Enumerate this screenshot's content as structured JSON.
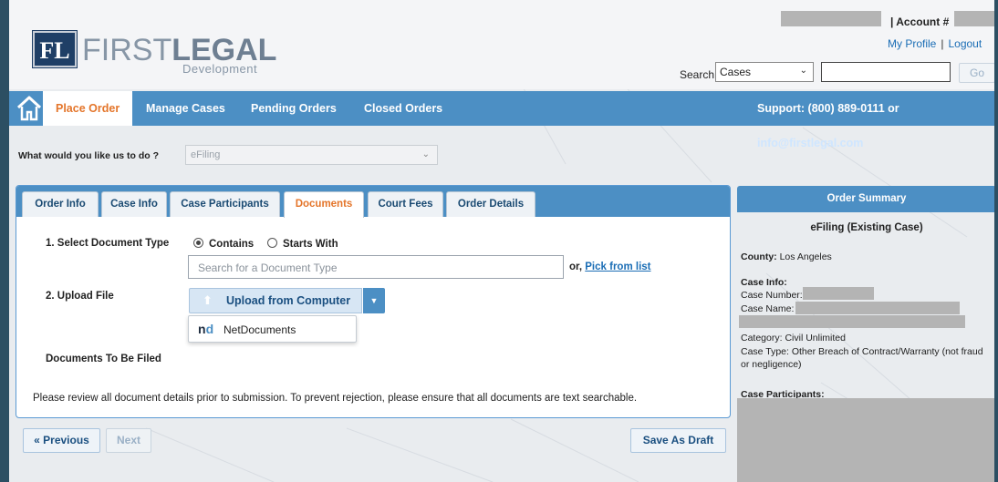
{
  "header": {
    "logo_mark": "FL",
    "logo_first": "FIRST",
    "logo_legal": "LEGAL",
    "logo_sub": "Development",
    "account_label": "| Account #",
    "my_profile": "My Profile",
    "separator": "|",
    "logout": "Logout",
    "search_label": "Search:",
    "search_scope": "Cases",
    "search_value": "",
    "go": "Go"
  },
  "nav": {
    "items": [
      "Place Order",
      "Manage Cases",
      "Pending Orders",
      "Closed Orders"
    ],
    "support_text": "Support: (800) 889-0111 or ",
    "support_email": "info@firstlegal.com"
  },
  "question": {
    "label": "What would you like us to do ?",
    "value": "eFiling"
  },
  "tabs": [
    "Order Info",
    "Case Info",
    "Case Participants",
    "Documents",
    "Court Fees",
    "Order Details"
  ],
  "active_tab": "Documents",
  "form": {
    "step1_label": "1. Select Document Type",
    "radio_contains": "Contains",
    "radio_starts": "Starts With",
    "doc_placeholder": "Search for a Document Type",
    "or_text": "or, ",
    "pick_link": "Pick from list",
    "step2_label": "2. Upload File",
    "upload_button": "Upload from Computer",
    "dropdown_item": "NetDocuments",
    "nd_logo_n": "n",
    "nd_logo_d": "d",
    "docs_to_file_label": "Documents To Be Filed",
    "notice": "Please review all document details prior to submission. To prevent rejection, please ensure that all documents are text searchable."
  },
  "buttons": {
    "previous": "« Previous",
    "next": "Next",
    "save_draft": "Save As Draft"
  },
  "summary": {
    "title": "Order Summary",
    "subtitle": "eFiling (Existing Case)",
    "county_label": "County:",
    "county_value": " Los Angeles",
    "case_info_label": "Case Info:",
    "case_number_label": "Case Number:",
    "case_name_label": "Case Name:",
    "category": "Category: Civil Unlimited",
    "case_type": "Case Type: Other Breach of Contract/Warranty (not fraud or negligence)",
    "participants_label": "Case Participants:"
  },
  "colors": {
    "nav_blue": "#4c8fc4",
    "active_orange": "#e4752a",
    "logo_navy": "#1f3f66",
    "link_blue": "#1a6db5"
  }
}
